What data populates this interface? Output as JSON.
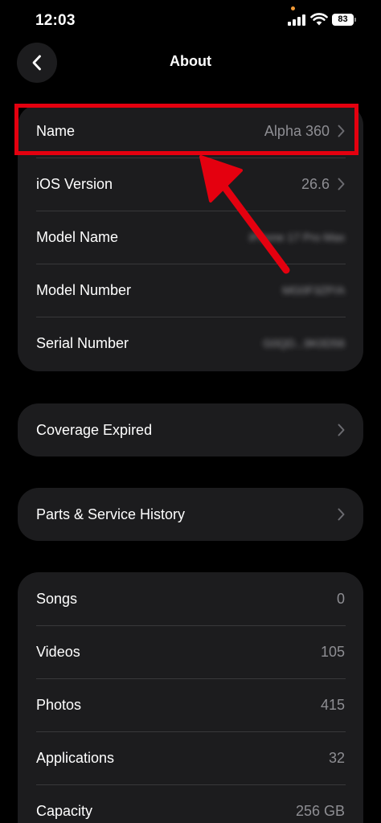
{
  "status_bar": {
    "time": "12:03",
    "battery": "83"
  },
  "nav": {
    "title": "About"
  },
  "device_info": [
    {
      "label": "Name",
      "value": "Alpha 360",
      "chevron": true,
      "blurred": false
    },
    {
      "label": "iOS Version",
      "value": "26.6",
      "chevron": true,
      "blurred": false
    },
    {
      "label": "Model Name",
      "value": "iPhone 17 Pro Max",
      "chevron": false,
      "blurred": true
    },
    {
      "label": "Model Number",
      "value": "MG0F3ZP/A",
      "chevron": false,
      "blurred": true
    },
    {
      "label": "Serial Number",
      "value": "G0QD...9K0D56",
      "chevron": false,
      "blurred": true
    }
  ],
  "coverage": {
    "label": "Coverage Expired"
  },
  "service": {
    "label": "Parts & Service History"
  },
  "media": [
    {
      "label": "Songs",
      "value": "0"
    },
    {
      "label": "Videos",
      "value": "105"
    },
    {
      "label": "Photos",
      "value": "415"
    },
    {
      "label": "Applications",
      "value": "32"
    },
    {
      "label": "Capacity",
      "value": "256 GB"
    }
  ],
  "colors": {
    "highlight": "#e4000f",
    "group_bg": "#1c1c1e",
    "value_text": "#8e8e93"
  }
}
